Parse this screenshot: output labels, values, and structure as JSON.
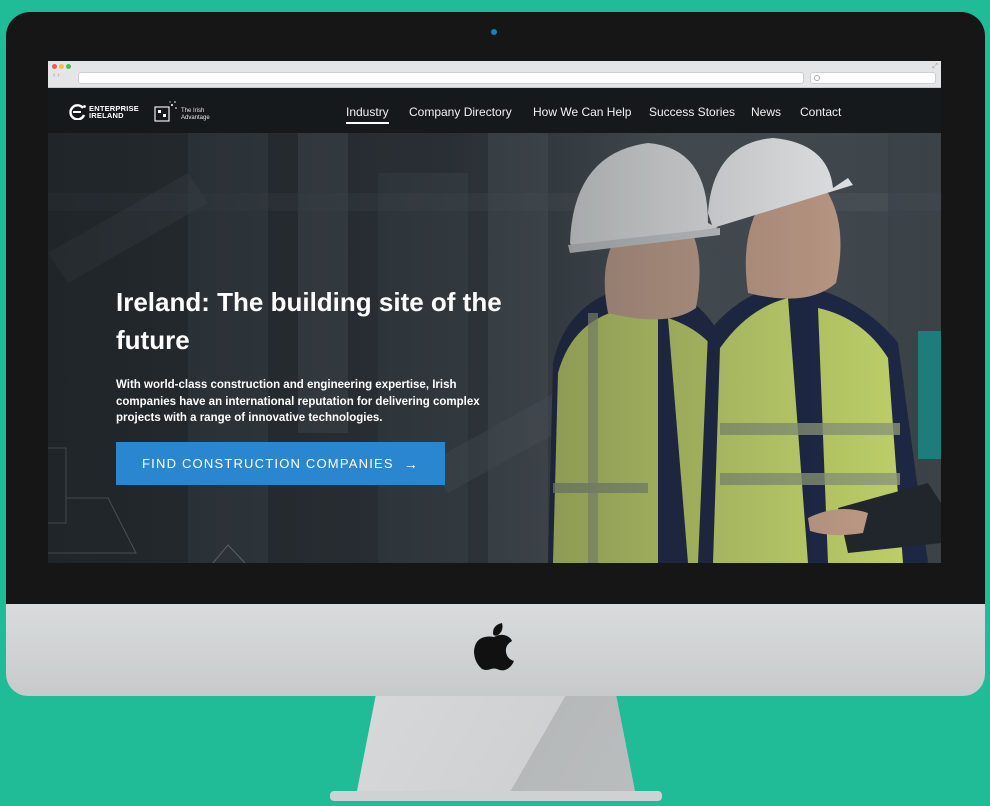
{
  "site": {
    "logo_line1": "ENTERPRISE",
    "logo_line2": "IRELAND",
    "tag_line1": "The Irish",
    "tag_line2": "Advantage"
  },
  "nav": {
    "items": [
      {
        "label": "Industry",
        "active": true
      },
      {
        "label": "Company Directory",
        "active": false
      },
      {
        "label": "How We Can Help",
        "active": false
      },
      {
        "label": "Success Stories",
        "active": false
      },
      {
        "label": "News",
        "active": false
      },
      {
        "label": "Contact",
        "active": false
      }
    ]
  },
  "hero": {
    "title": "Ireland: The building site of the future",
    "body": "With world-class construction and engineering expertise, Irish companies have an international reputation for delivering complex projects with a range of innovative technologies.",
    "cta_label": "FIND CONSTRUCTION COMPANIES",
    "cta_arrow": "→"
  },
  "colors": {
    "background": "#20bb97",
    "cta": "#2b86d0",
    "header": "#16191c",
    "accent_tab": "#1e7d7a"
  },
  "icons": [
    "apple-logo-icon",
    "enterprise-ireland-logo-icon",
    "irish-advantage-logo-icon",
    "arrow-right-icon",
    "search-icon"
  ]
}
